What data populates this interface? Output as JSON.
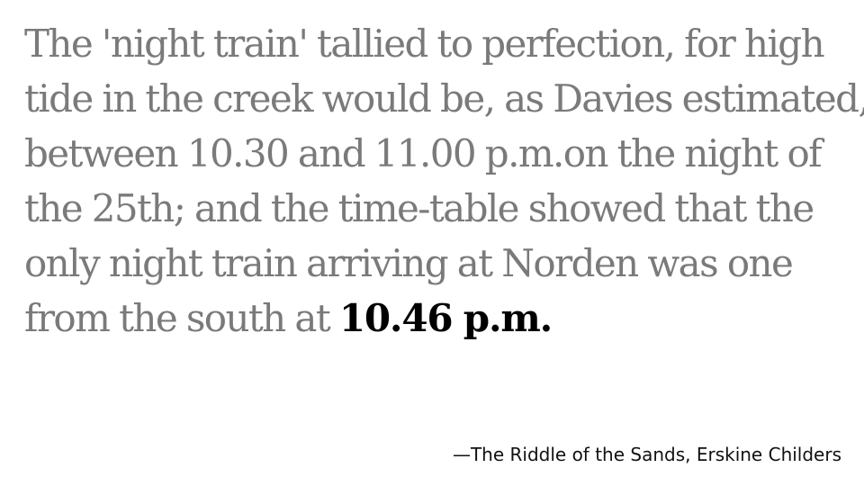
{
  "quote": {
    "lines": [
      "The 'night train' tallied to perfection, for high",
      "tide in the creek would be, as Davies estimated,",
      "between 10.30 and 11.00 p.m.on the night of",
      "the 25th; and the time-table showed that the",
      "only night train arriving at Norden was one",
      "from the south at "
    ],
    "highlight": "10.46 p.m."
  },
  "attribution": "—The Riddle of the Sands, Erskine Childers",
  "colors": {
    "background": "#ffffff",
    "quote_text": "#7a7a7a",
    "highlight_text": "#000000",
    "attribution_text": "#111111"
  }
}
